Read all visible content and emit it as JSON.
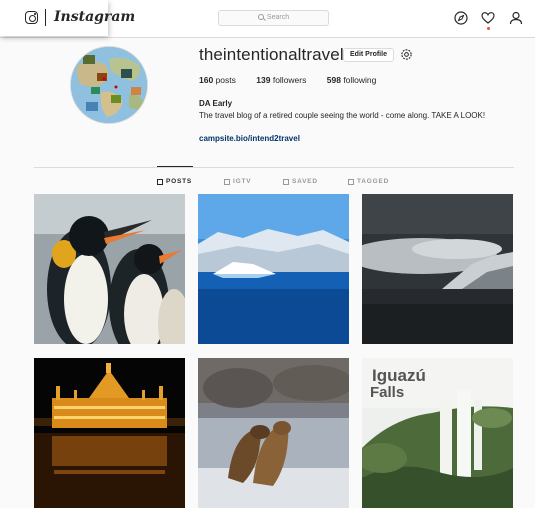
{
  "header": {
    "wordmark": "Instagram",
    "search_placeholder": "Search",
    "icons": [
      "camera-logo-icon",
      "compass-icon",
      "heart-icon",
      "person-icon"
    ],
    "notification_dot_color": "#ed4956"
  },
  "profile": {
    "username": "theintentionaltraveler",
    "edit_label": "Edit Profile",
    "stats": {
      "posts_value": "160",
      "posts_label": "posts",
      "followers_value": "139",
      "followers_label": "followers",
      "following_value": "598",
      "following_label": "following"
    },
    "full_name": "DA Early",
    "bio": "The travel blog of a retired couple seeing the world - come along. TAKE A LOOK!",
    "website": "campsite.bio/intend2travel"
  },
  "tabs": {
    "posts": "POSTS",
    "igtv": "IGTV",
    "saved": "SAVED",
    "tagged": "TAGGED",
    "active": "POSTS"
  },
  "grid": {
    "posts": [
      {
        "label": ""
      },
      {
        "label": ""
      },
      {
        "label": ""
      },
      {
        "label": ""
      },
      {
        "label": ""
      },
      {
        "caption_line1": "Iguazú",
        "caption_line2": "Falls"
      }
    ]
  }
}
